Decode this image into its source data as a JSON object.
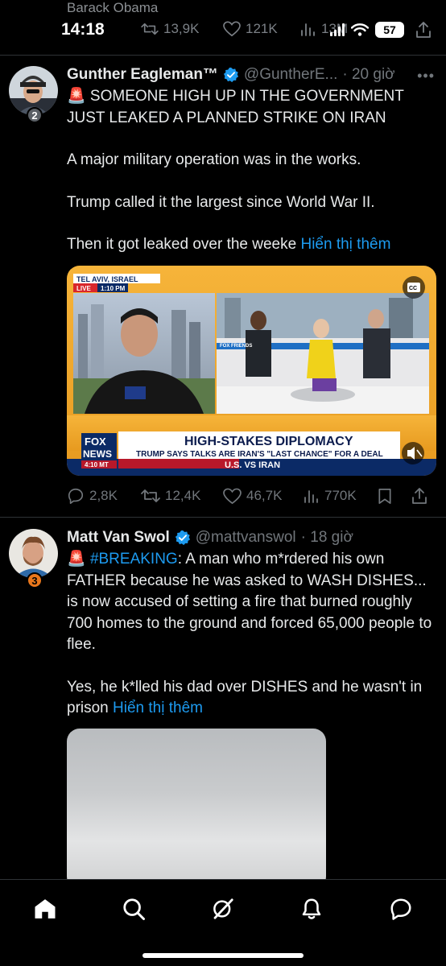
{
  "status_bar": {
    "prev_author": "Barack Obama",
    "time": "14:18",
    "prev_retweets": "13,9K",
    "prev_likes": "121K",
    "prev_views": "13M",
    "battery": "57"
  },
  "tweets": [
    {
      "name": "Gunther Eagleman™",
      "handle": "@GuntherE...",
      "time": "· 20 giờ",
      "rank": "2",
      "lines": [
        "🚨 SOMEONE HIGH UP IN THE GOVERNMENT JUST LEAKED A PLANNED STRIKE ON IRAN",
        "A major military operation was in the works.",
        "Trump called it the largest since World War II.",
        "Then it got leaked over the weeke"
      ],
      "show_more": "Hiển thị thêm",
      "media": {
        "location": "TEL AVIV, ISRAEL",
        "live": "LIVE",
        "live_time": "1:10 PM",
        "headline": "HIGH-STAKES DIPLOMACY",
        "subheadline": "TRUMP SAYS TALKS ARE IRAN'S \"LAST CHANCE\" FOR A DEAL",
        "ticker": "U.S. VS IRAN",
        "network_line1": "FOX",
        "network_line2": "NEWS",
        "clock": "4:10 MT",
        "cc": "CC",
        "studio_brand": "FOX FRIENDS"
      },
      "stats": {
        "replies": "2,8K",
        "retweets": "12,4K",
        "likes": "46,7K",
        "views": "770K"
      }
    },
    {
      "name": "Matt Van Swol",
      "handle": "@mattvanswol",
      "time": "· 18 giờ",
      "rank": "3",
      "hashtag": "#BREAKING",
      "line1_rest": ": A man who m*rdered his own FATHER because he was asked to WASH DISHES... is now accused of setting a fire that burned roughly 700 homes to the ground and forced 65,000 people to flee.",
      "line2": "Yes, he k*lled his dad over DISHES and he wasn't in prison",
      "show_more": "Hiển thị thêm"
    }
  ],
  "colors": {
    "background": "#000000",
    "text": "#e7e9ea",
    "muted": "#71767b",
    "link": "#1d9bf0",
    "verified": "#1d9bf0",
    "separator": "#2f3336"
  }
}
